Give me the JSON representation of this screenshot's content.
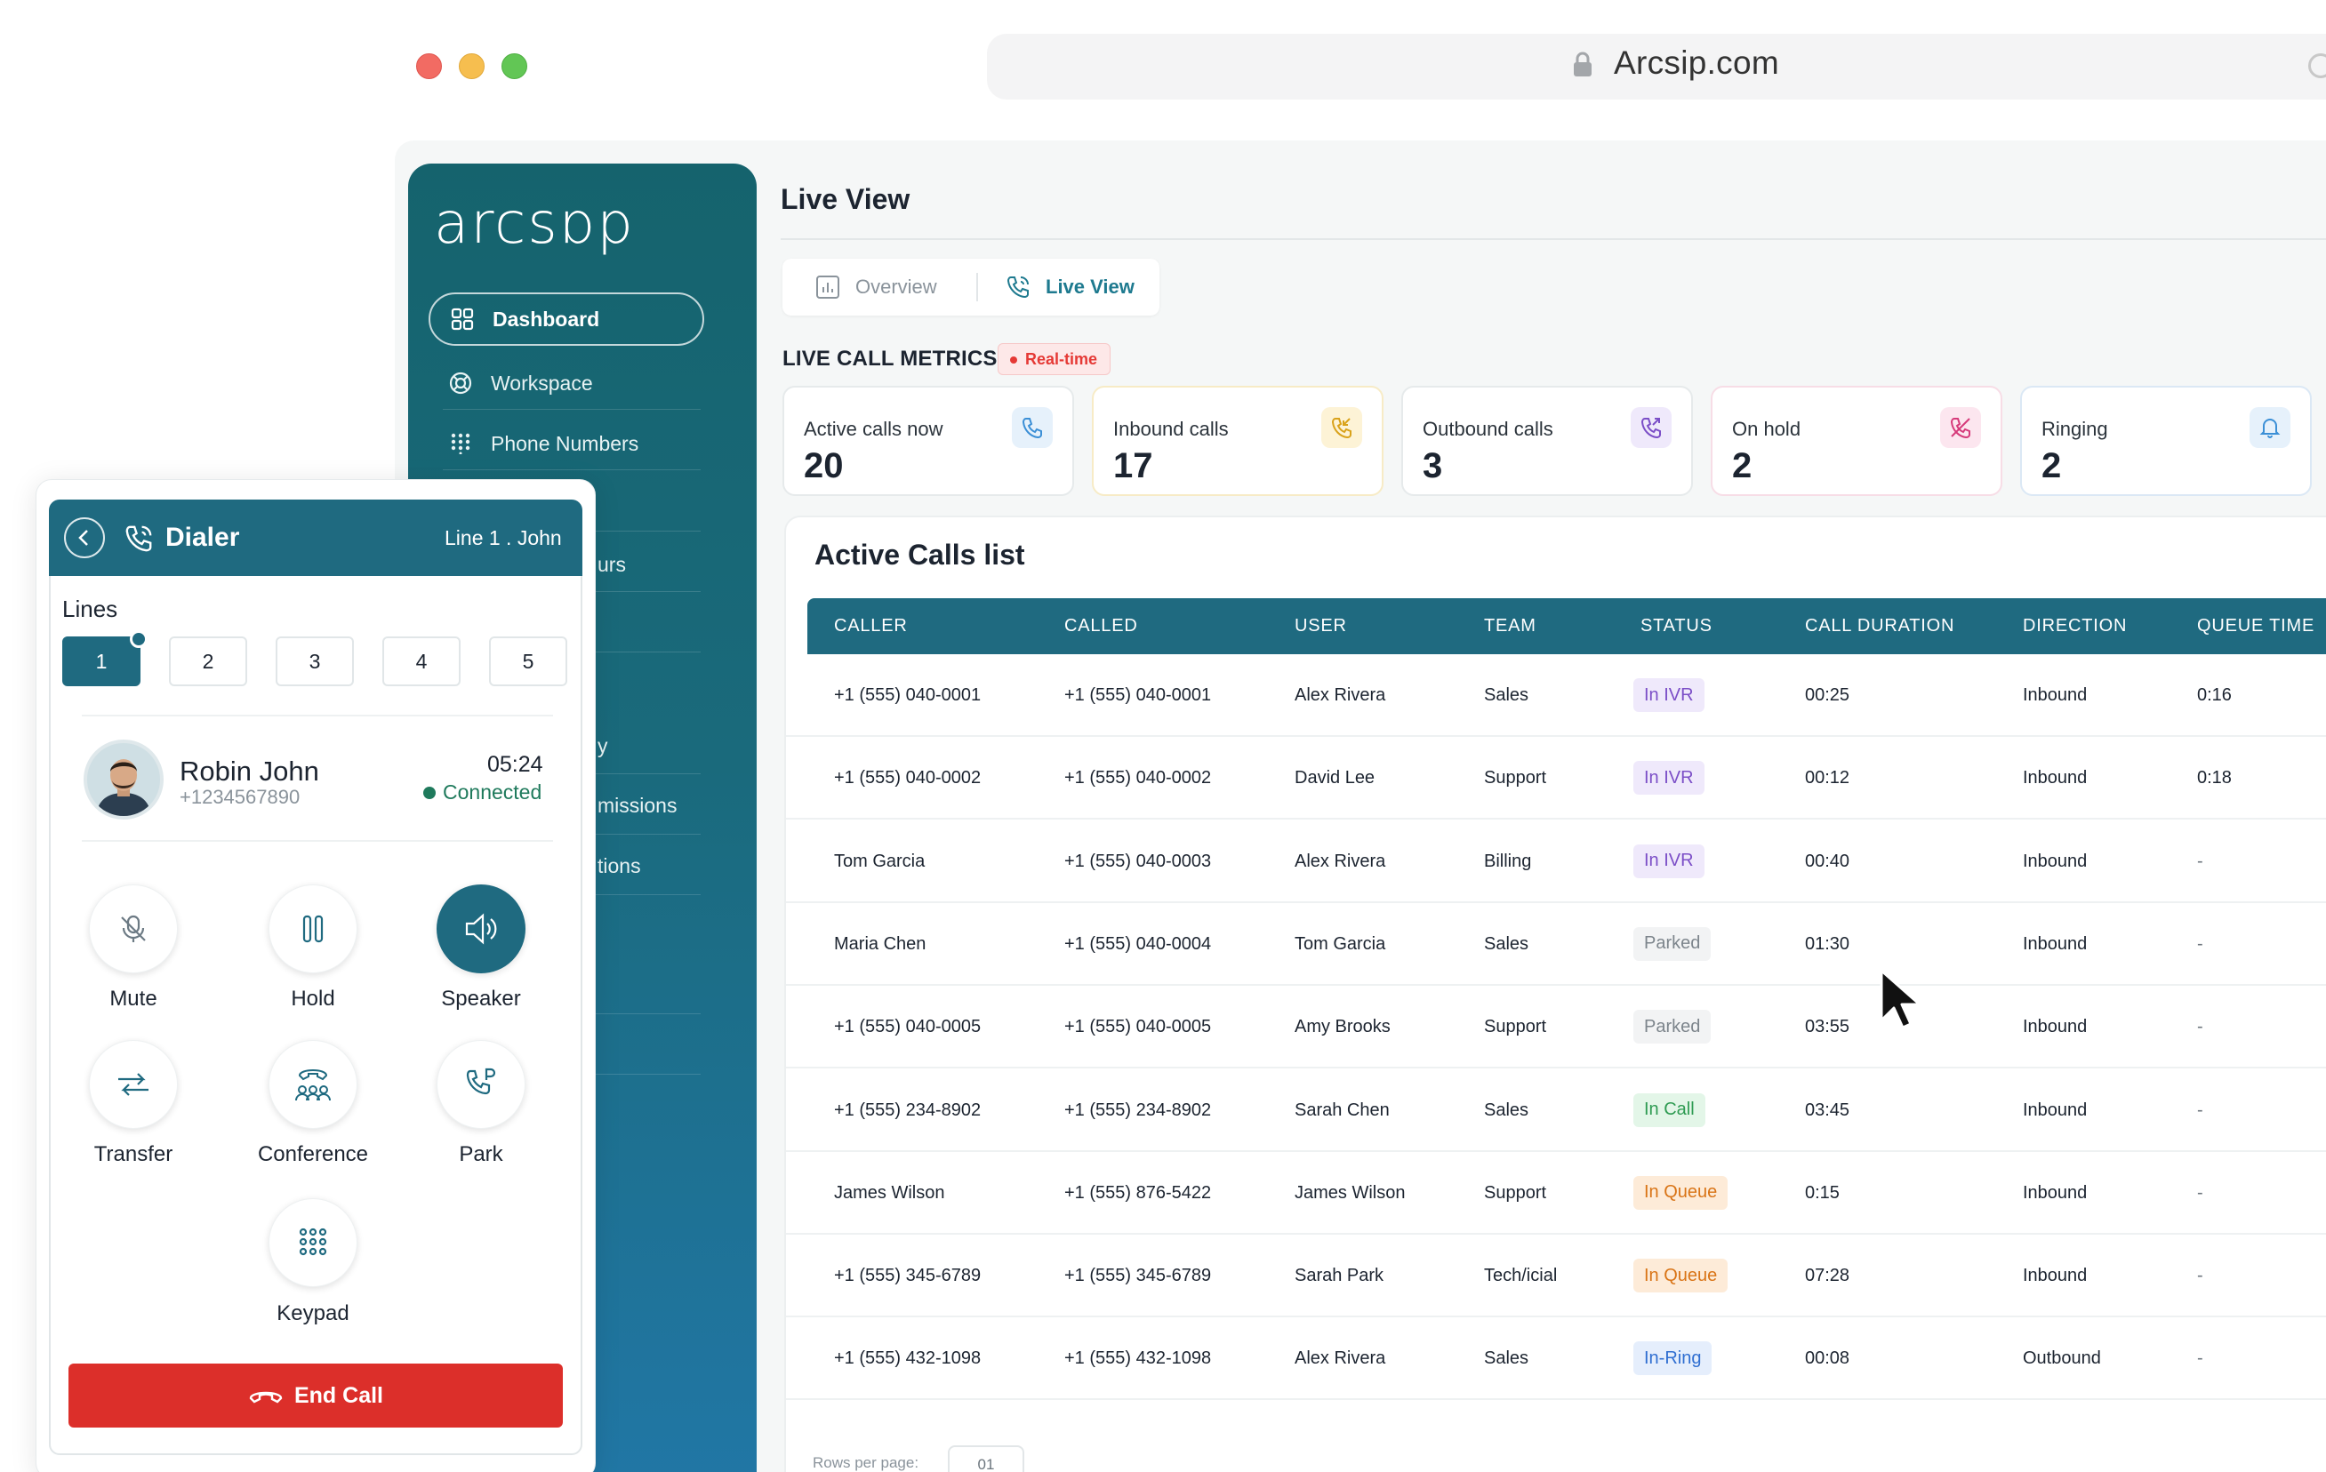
{
  "browser": {
    "url": "Arcsip.com"
  },
  "sidebar": {
    "logo": "arcsɒp",
    "items": [
      {
        "label": "Dashboard",
        "icon": "grid-icon"
      },
      {
        "label": "Workspace",
        "icon": "workspace-icon"
      },
      {
        "label": "Phone Numbers",
        "icon": "keypad-dots-icon"
      }
    ],
    "partial_items": [
      "urs",
      "y",
      "missions",
      "tions"
    ]
  },
  "main": {
    "title": "Live View",
    "tabs": [
      {
        "label": "Overview",
        "icon": "bar-chart-icon"
      },
      {
        "label": "Live View",
        "icon": "phone-waves-icon"
      }
    ],
    "metrics_title": "LIVE CALL METRICS",
    "realtime_badge": "Real-time",
    "metrics": [
      {
        "label": "Active calls now",
        "value": "20",
        "icon": "phone-icon",
        "color": "#3b8fd6",
        "bg": "#e6f1fb",
        "border": "#e6eaeb"
      },
      {
        "label": "Inbound calls",
        "value": "17",
        "icon": "phone-incoming-icon",
        "color": "#d9a21a",
        "bg": "#fdf3d6",
        "border": "#f7ebc6"
      },
      {
        "label": "Outbound calls",
        "value": "3",
        "icon": "phone-outgoing-icon",
        "color": "#7b4ec7",
        "bg": "#efe9fb",
        "border": "#e6eaeb"
      },
      {
        "label": "On hold",
        "value": "2",
        "icon": "phone-hold-icon",
        "color": "#d63a7a",
        "bg": "#fce6ef",
        "border": "#f7dde6"
      },
      {
        "label": "Ringing",
        "value": "2",
        "icon": "bell-icon",
        "color": "#3b8fd6",
        "bg": "#e6f1fb",
        "border": "#dbe8f5"
      }
    ]
  },
  "table": {
    "title": "Active Calls list",
    "columns": [
      "CALLER",
      "CALLED",
      "USER",
      "TEAM",
      "STATUS",
      "CALL DURATION",
      "DIRECTION",
      "QUEUE TIME"
    ],
    "rows": [
      {
        "caller": "+1 (555) 040-0001",
        "called": "+1 (555) 040-0001",
        "user": "Alex Rivera",
        "team": "Sales",
        "status": "In IVR",
        "duration": "00:25",
        "direction": "Inbound",
        "queue": "0:16"
      },
      {
        "caller": "+1 (555) 040-0002",
        "called": "+1 (555) 040-0002",
        "user": "David Lee",
        "team": "Support",
        "status": "In IVR",
        "duration": "00:12",
        "direction": "Inbound",
        "queue": "0:18"
      },
      {
        "caller": "Tom Garcia",
        "called": "+1 (555) 040-0003",
        "user": "Alex Rivera",
        "team": "Billing",
        "status": "In IVR",
        "duration": "00:40",
        "direction": "Inbound",
        "queue": "-"
      },
      {
        "caller": "Maria Chen",
        "called": "+1 (555) 040-0004",
        "user": "Tom Garcia",
        "team": "Sales",
        "status": "Parked",
        "duration": "01:30",
        "direction": "Inbound",
        "queue": "-"
      },
      {
        "caller": "+1 (555) 040-0005",
        "called": "+1 (555) 040-0005",
        "user": "Amy Brooks",
        "team": "Support",
        "status": "Parked",
        "duration": "03:55",
        "direction": "Inbound",
        "queue": "-"
      },
      {
        "caller": "+1 (555) 234-8902",
        "called": "+1 (555) 234-8902",
        "user": "Sarah Chen",
        "team": "Sales",
        "status": "In Call",
        "duration": "03:45",
        "direction": "Inbound",
        "queue": "-"
      },
      {
        "caller": "James Wilson",
        "called": "+1 (555) 876-5422",
        "user": "James Wilson",
        "team": "Support",
        "status": "In Queue",
        "duration": "0:15",
        "direction": "Inbound",
        "queue": "-"
      },
      {
        "caller": "+1 (555) 345-6789",
        "called": "+1 (555) 345-6789",
        "user": "Sarah Park",
        "team": "Tech/icial",
        "status": "In Queue",
        "duration": "07:28",
        "direction": "Inbound",
        "queue": "-"
      },
      {
        "caller": "+1 (555) 432-1098",
        "called": "+1 (555) 432-1098",
        "user": "Alex Rivera",
        "team": "Sales",
        "status": "In-Ring",
        "duration": "00:08",
        "direction": "Outbound",
        "queue": "-"
      }
    ],
    "rows_per_page_label": "Rows per page:",
    "rows_per_page_value": "01"
  },
  "dialer": {
    "title": "Dialer",
    "line_info": "Line 1 . John",
    "lines_label": "Lines",
    "lines": [
      "1",
      "2",
      "3",
      "4",
      "5"
    ],
    "active_line": "1",
    "caller_name": "Robin John",
    "caller_number": "+1234567890",
    "timer": "05:24",
    "status": "Connected",
    "controls": [
      {
        "label": "Mute",
        "icon": "mic-off-icon",
        "active": false
      },
      {
        "label": "Hold",
        "icon": "pause-icon",
        "active": false
      },
      {
        "label": "Speaker",
        "icon": "speaker-icon",
        "active": true
      },
      {
        "label": "Transfer",
        "icon": "transfer-icon",
        "active": false
      },
      {
        "label": "Conference",
        "icon": "conference-icon",
        "active": false
      },
      {
        "label": "Park",
        "icon": "park-icon",
        "active": false
      },
      {
        "label": "Keypad",
        "icon": "keypad-icon",
        "active": false
      }
    ],
    "end_call": "End Call"
  }
}
